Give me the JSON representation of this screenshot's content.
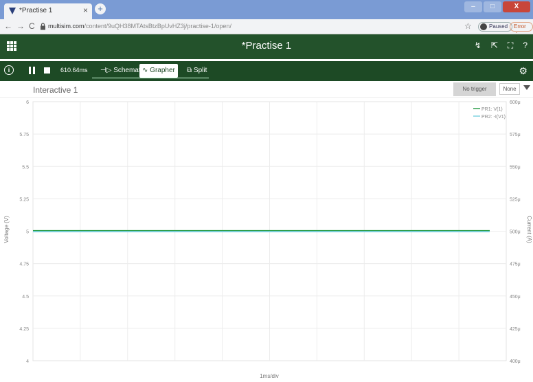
{
  "browser": {
    "tab_title": "*Practise 1",
    "tab_close": "×",
    "new_tab": "+",
    "window": {
      "minimize": "–",
      "maximize": "□",
      "close": "X"
    },
    "nav": {
      "back": "←",
      "forward": "→",
      "reload": "C"
    },
    "url_host": "multisim.com",
    "url_path": "/content/9uQH38MTAtsBtzBpUvHZ3j/practise-1/open/",
    "star": "☆",
    "paused_label": "Paused",
    "error_label": "Error"
  },
  "app": {
    "title": "*Practise 1",
    "header_icons": {
      "probe": "↯",
      "export": "⇱",
      "fullscreen": "⛶",
      "help": "?"
    }
  },
  "toolbar": {
    "info": "i",
    "time": "610.64ms",
    "schematic_label": "Schematic",
    "grapher_label": "Grapher",
    "split_label": "Split",
    "gear": "⚙"
  },
  "graph": {
    "title": "Interactive 1",
    "trigger_label": "No trigger",
    "mode_value": "None"
  },
  "chart_data": {
    "type": "line",
    "xlabel": "1ms/div",
    "ylabel": "Voltage (V)",
    "y2label": "Current (A)",
    "ylim": [
      4,
      6
    ],
    "y_ticks": [
      "6",
      "5.75",
      "5.5",
      "5.25",
      "5",
      "4.75",
      "4.5",
      "4.25",
      "4"
    ],
    "y2lim": [
      400,
      600
    ],
    "y2_ticks": [
      "600μ",
      "575μ",
      "550μ",
      "525μ",
      "500μ",
      "475μ",
      "450μ",
      "425μ",
      "400μ"
    ],
    "x_divisions": 10,
    "grid": true,
    "legend_position": "top-right",
    "series": [
      {
        "name": "PR1: V(1)",
        "color": "#2e9e4a",
        "axis": "left",
        "value": 5
      },
      {
        "name": "PR2: -I(V1)",
        "color": "#7fd3e0",
        "axis": "right",
        "value": 500
      }
    ]
  }
}
